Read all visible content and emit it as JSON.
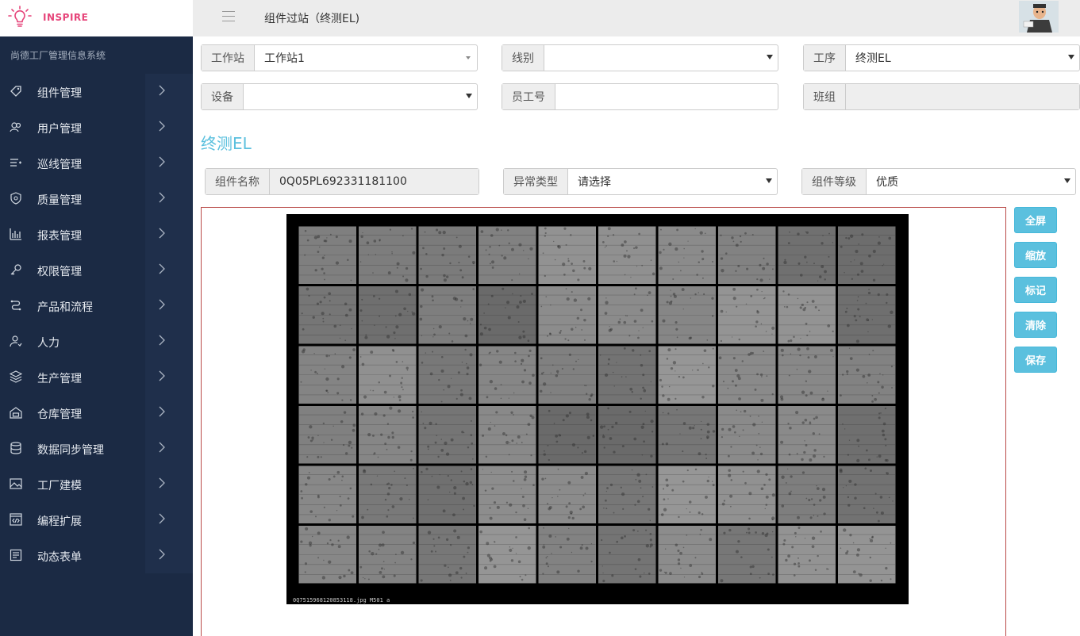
{
  "brand": {
    "name": "INSPIRE",
    "system_name": "尚德工厂管理信息系统"
  },
  "header": {
    "title": "组件过站（终测EL)"
  },
  "sidebar": {
    "items": [
      {
        "label": "组件管理",
        "icon": "tag-icon"
      },
      {
        "label": "用户管理",
        "icon": "users-icon"
      },
      {
        "label": "巡线管理",
        "icon": "list-icon"
      },
      {
        "label": "质量管理",
        "icon": "shield-icon"
      },
      {
        "label": "报表管理",
        "icon": "bar-chart-icon"
      },
      {
        "label": "权限管理",
        "icon": "key-icon"
      },
      {
        "label": "产品和流程",
        "icon": "flow-icon"
      },
      {
        "label": "人力",
        "icon": "person-icon"
      },
      {
        "label": "生产管理",
        "icon": "layers-icon"
      },
      {
        "label": "仓库管理",
        "icon": "warehouse-icon"
      },
      {
        "label": "数据同步管理",
        "icon": "database-icon"
      },
      {
        "label": "工厂建模",
        "icon": "image-icon"
      },
      {
        "label": "编程扩展",
        "icon": "code-icon"
      },
      {
        "label": "动态表单",
        "icon": "form-icon"
      }
    ]
  },
  "form": {
    "workstation": {
      "label": "工作站",
      "value": "工作站1"
    },
    "line": {
      "label": "线别",
      "value": ""
    },
    "process": {
      "label": "工序",
      "value": "终测EL"
    },
    "device": {
      "label": "设备",
      "value": ""
    },
    "employee_id": {
      "label": "员工号",
      "value": ""
    },
    "shift": {
      "label": "班组",
      "value": ""
    }
  },
  "section": {
    "title": "终测EL",
    "module_name": {
      "label": "组件名称",
      "value": "0Q05PL692331181100"
    },
    "anomaly_type": {
      "label": "异常类型",
      "value": "请选择"
    },
    "module_grade": {
      "label": "组件等级",
      "value": "优质"
    }
  },
  "image": {
    "caption": "0Q7515968120853118.jpg    M501    a"
  },
  "actions": {
    "fullscreen": "全屏",
    "zoom": "缩放",
    "mark": "标记",
    "clear": "清除",
    "save": "保存"
  },
  "colors": {
    "sidebar_bg": "#1b2a44",
    "accent": "#5bc0de",
    "brand": "#e6457a",
    "panel_border": "#b94a48"
  }
}
